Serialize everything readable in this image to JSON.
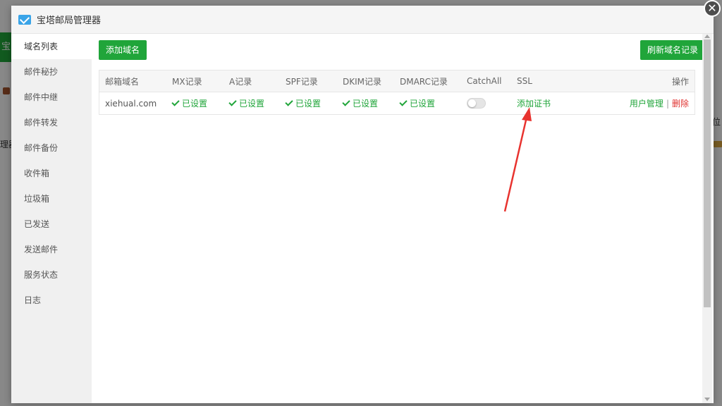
{
  "background": {
    "left_fragment": "理器",
    "right_fragment": "位"
  },
  "modal": {
    "title": "宝塔邮局管理器",
    "close_glyph": "✕"
  },
  "sidebar": {
    "items": [
      {
        "label": "域名列表"
      },
      {
        "label": "邮件秘抄"
      },
      {
        "label": "邮件中继"
      },
      {
        "label": "邮件转发"
      },
      {
        "label": "邮件备份"
      },
      {
        "label": "收件箱"
      },
      {
        "label": "垃圾箱"
      },
      {
        "label": "已发送"
      },
      {
        "label": "发送邮件"
      },
      {
        "label": "服务状态"
      },
      {
        "label": "日志"
      }
    ]
  },
  "toolbar": {
    "add_domain_label": "添加域名",
    "refresh_label": "刷新域名记录"
  },
  "table": {
    "headers": [
      "邮箱域名",
      "MX记录",
      "A记录",
      "SPF记录",
      "DKIM记录",
      "DMARC记录",
      "CatchAll",
      "SSL",
      "操作"
    ],
    "rows": [
      {
        "domain": "xiehual.com",
        "mx": "已设置",
        "a": "已设置",
        "spf": "已设置",
        "dkim": "已设置",
        "dmarc": "已设置",
        "catchall_on": false,
        "ssl": "添加证书",
        "action_users": "用户管理",
        "action_sep": "|",
        "action_delete": "删除"
      }
    ]
  },
  "colors": {
    "accent": "#20a53a",
    "danger": "#e0312f",
    "annotation_arrow": "#e8332f"
  }
}
